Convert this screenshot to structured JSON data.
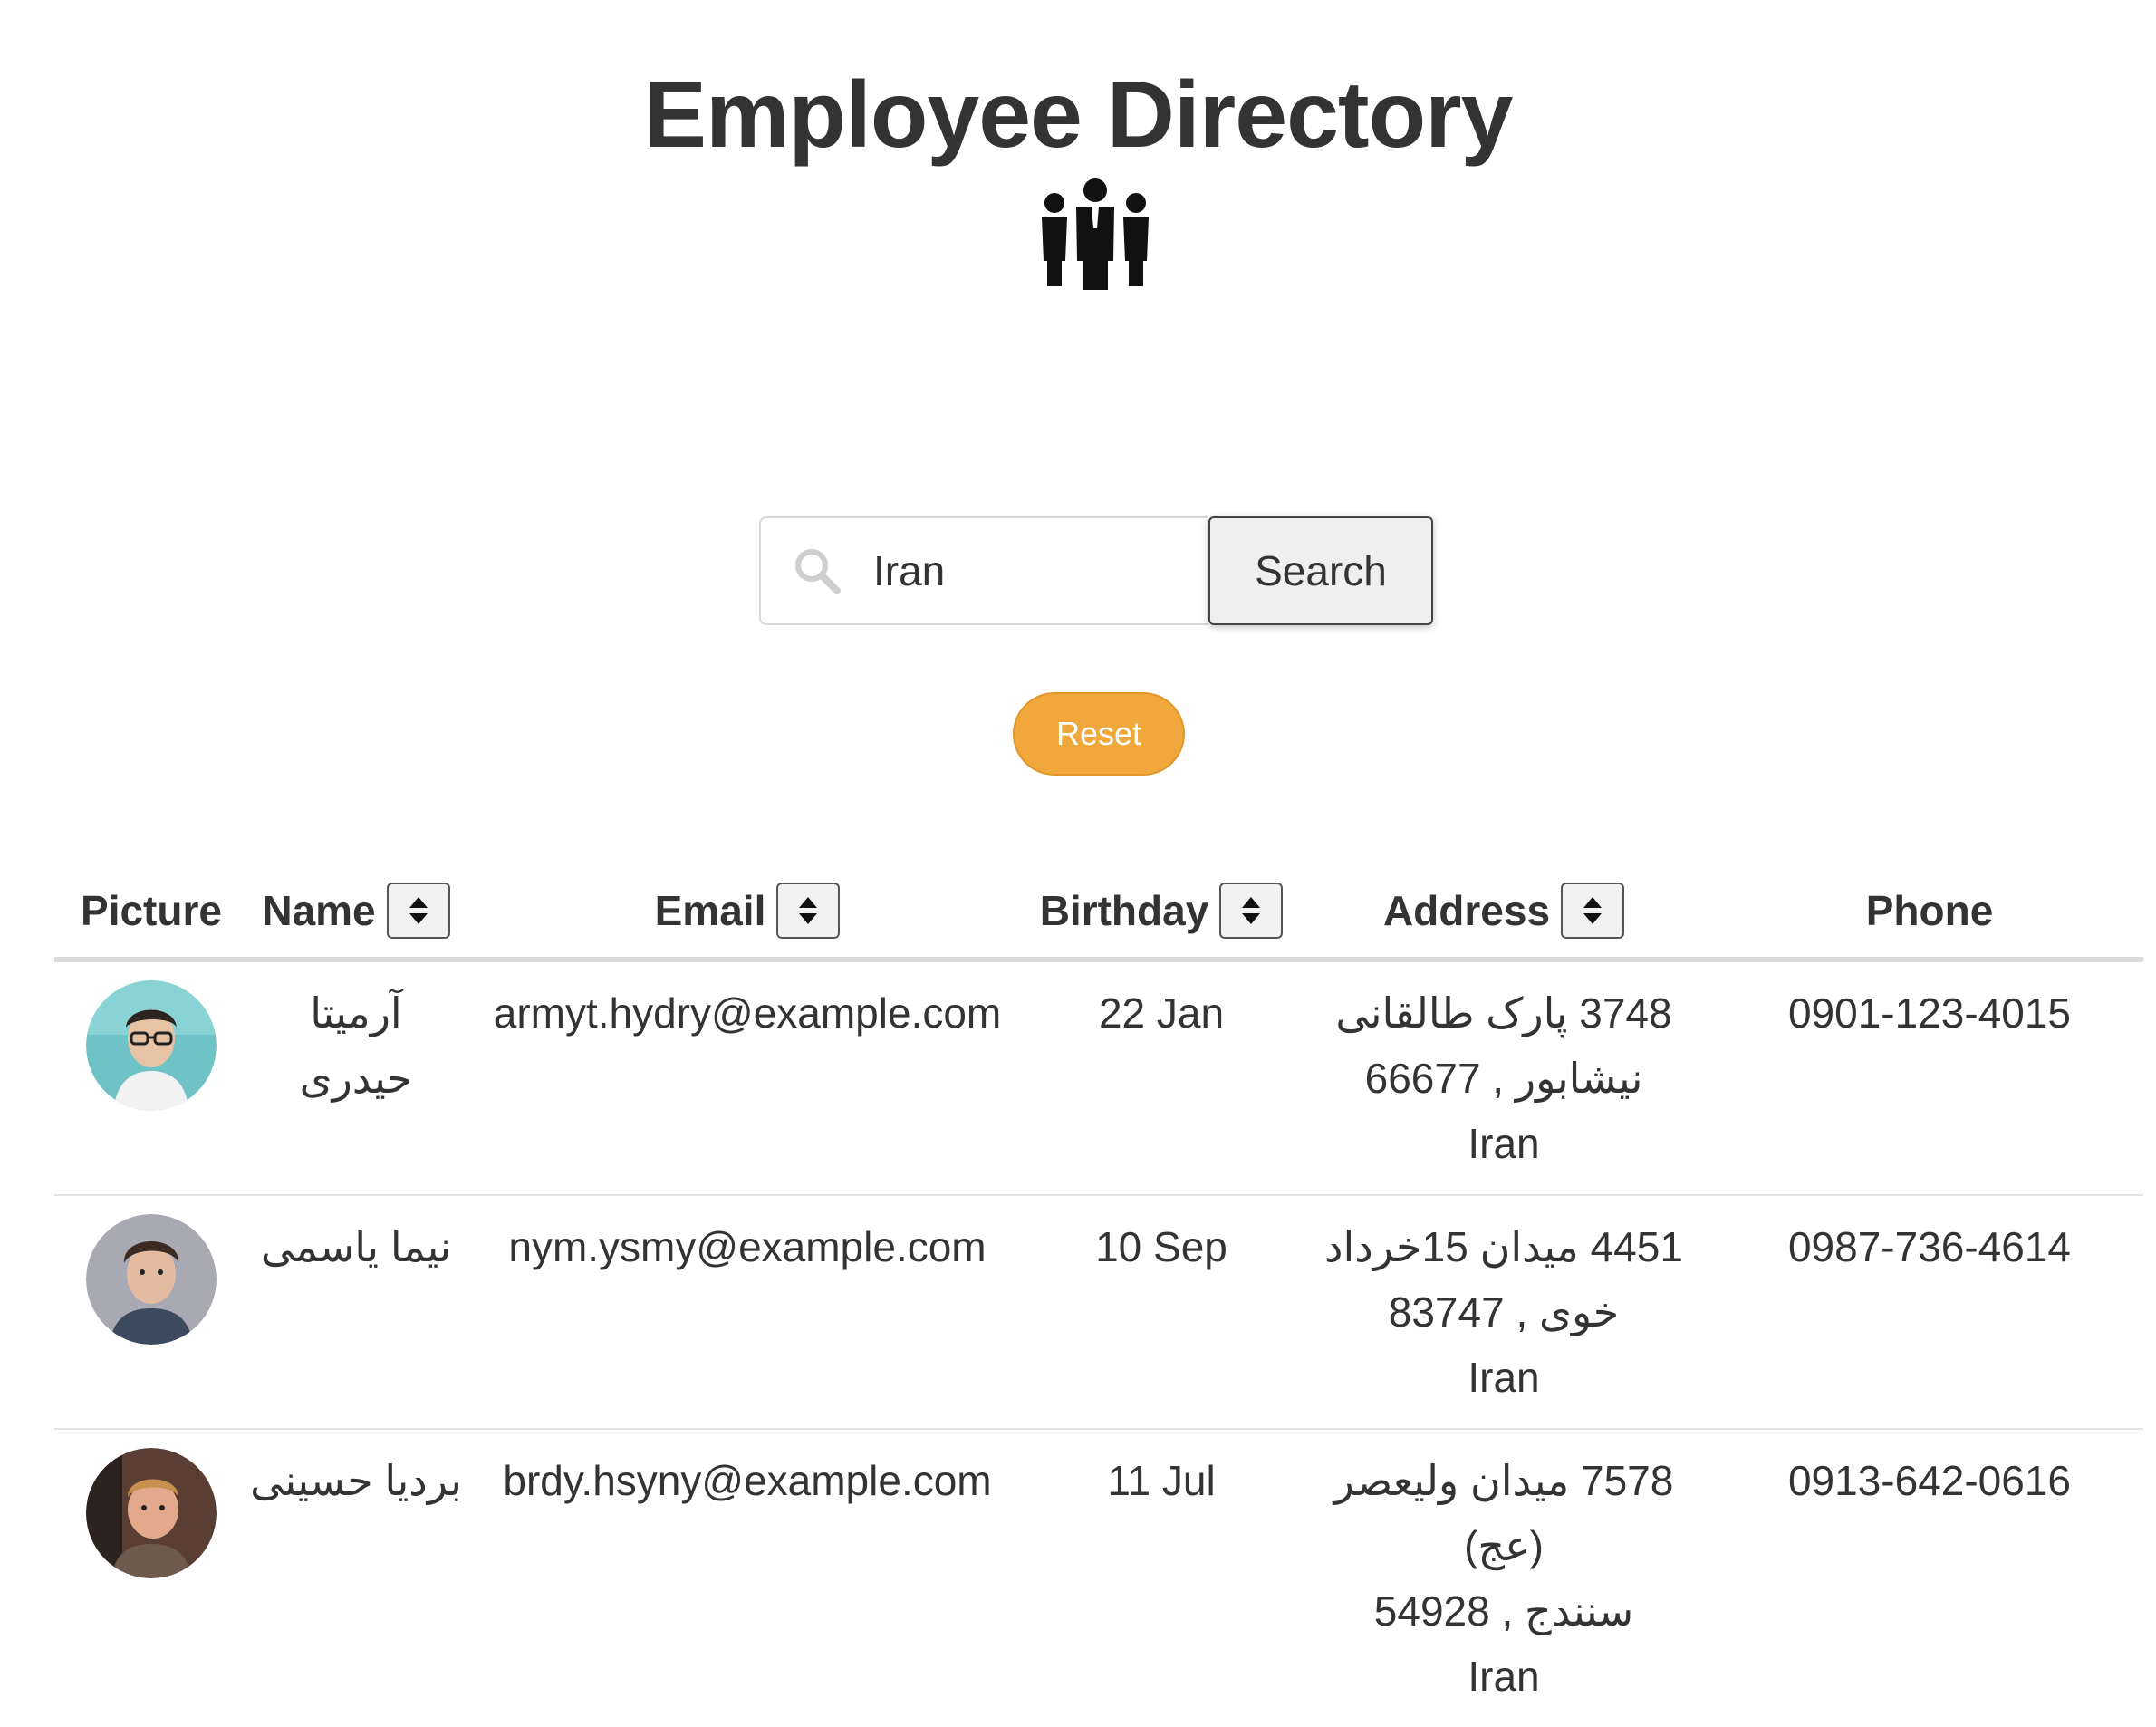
{
  "header": {
    "title": "Employee Directory",
    "icon": "people-group-icon"
  },
  "search": {
    "value": "Iran",
    "placeholder": "",
    "button_label": "Search",
    "icon": "search-icon"
  },
  "reset": {
    "label": "Reset",
    "color": "#f0a73b"
  },
  "table": {
    "columns": [
      {
        "label": "Picture",
        "sortable": false
      },
      {
        "label": "Name",
        "sortable": true
      },
      {
        "label": "Email",
        "sortable": true
      },
      {
        "label": "Birthday",
        "sortable": true
      },
      {
        "label": "Address",
        "sortable": true
      },
      {
        "label": "Phone",
        "sortable": false
      }
    ],
    "rows": [
      {
        "name": "آرمیتا حیدری",
        "email": "armyt.hydry@example.com",
        "birthday": "22 Jan",
        "address_line1": "3748 پارک طالقانی",
        "address_line2": "نیشابور , 66677",
        "address_line3": "Iran",
        "phone": "0901-123-4015"
      },
      {
        "name": "نیما یاسمی",
        "email": "nym.ysmy@example.com",
        "birthday": "10 Sep",
        "address_line1": "4451 میدان 15خرداد",
        "address_line2": "خوی , 83747",
        "address_line3": "Iran",
        "phone": "0987-736-4614"
      },
      {
        "name": "بردیا حسینی",
        "email": "brdy.hsyny@example.com",
        "birthday": "11 Jul",
        "address_line1": "7578 میدان ولیعصر (عج)",
        "address_line2": "سنندج , 54928",
        "address_line3": "Iran",
        "phone": "0913-642-0616"
      }
    ]
  }
}
